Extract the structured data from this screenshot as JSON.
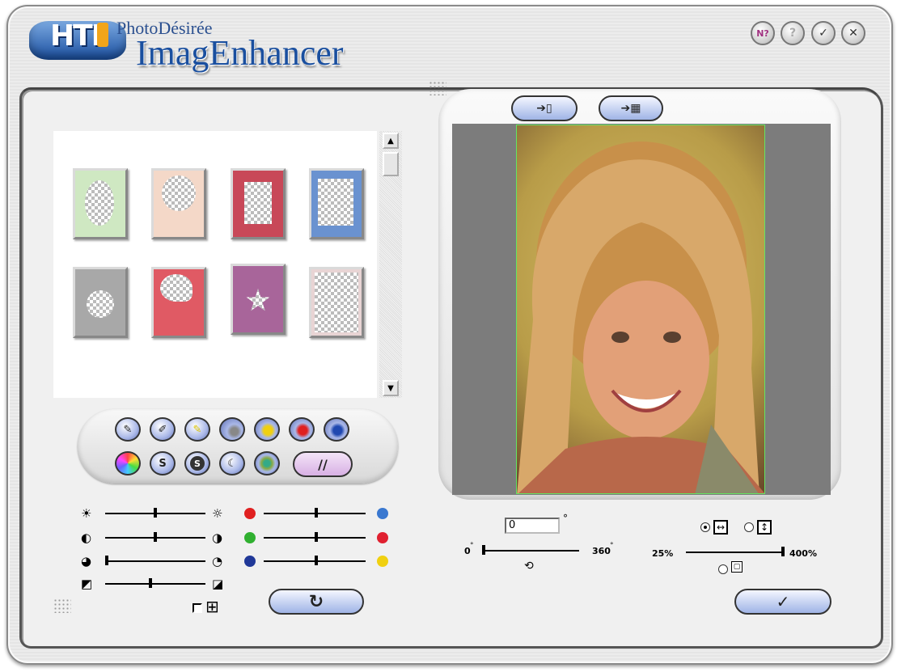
{
  "title": {
    "brand_small": "PhotoDésirée",
    "brand_large": "ImagEnhancer",
    "logo_text": "HTI"
  },
  "title_buttons": [
    {
      "name": "help-button",
      "glyph": "N?"
    },
    {
      "name": "info-button",
      "glyph": "?"
    },
    {
      "name": "ok-button",
      "glyph": "✓"
    },
    {
      "name": "close-button",
      "glyph": "✕"
    }
  ],
  "frames": [
    {
      "name": "frame-thumb-green-oval",
      "color": "#cfe8c2"
    },
    {
      "name": "frame-thumb-floral",
      "color": "#f4d8c8"
    },
    {
      "name": "frame-thumb-red-rect",
      "color": "#c84858"
    },
    {
      "name": "frame-thumb-blue-brush",
      "color": "#6a92d0"
    },
    {
      "name": "frame-thumb-rose-wreath",
      "color": "#a8a8a8"
    },
    {
      "name": "frame-thumb-heart",
      "color": "#e05a64"
    },
    {
      "name": "frame-thumb-purple-star",
      "color": "#a8659a"
    },
    {
      "name": "frame-thumb-corner-roses",
      "color": "#e8d4d4"
    }
  ],
  "tools_row1": [
    "pen-tool",
    "clip-tool",
    "highlight-pen-tool",
    "gray-tool",
    "yellow-tool",
    "red-tool",
    "blue-tool"
  ],
  "tools_row2": [
    "rainbow-tool",
    "s-outline-tool",
    "s-solid-tool",
    "moon-tool",
    "mosaic-tool"
  ],
  "tool_labels": {
    "s_outline": "S",
    "s_solid": "S",
    "slash_button": "//"
  },
  "sliders": {
    "brightness": 0.5,
    "contrast": 0.5,
    "saturation": 0.0,
    "gamma": 0.45,
    "red_cyan": 0.5,
    "green_magenta": 0.5,
    "blue_yellow": 0.5
  },
  "colors": {
    "red": "#e02020",
    "blue": "#3a78d0",
    "green": "#30b030",
    "darkblue": "#203898",
    "yellow": "#f0d010",
    "accent": "#a0b8e8"
  },
  "rotation": {
    "value": "0",
    "degree_symbol": "°",
    "min_label": "0",
    "max_label": "360",
    "position": 0.0
  },
  "zoom": {
    "min_label": "25%",
    "max_label": "400%",
    "position": 1.0,
    "fit_mode": "width"
  },
  "actions": {
    "reset_glyph": "↻",
    "apply_glyph": "✓",
    "rotate_glyph": "⟲⟳"
  }
}
